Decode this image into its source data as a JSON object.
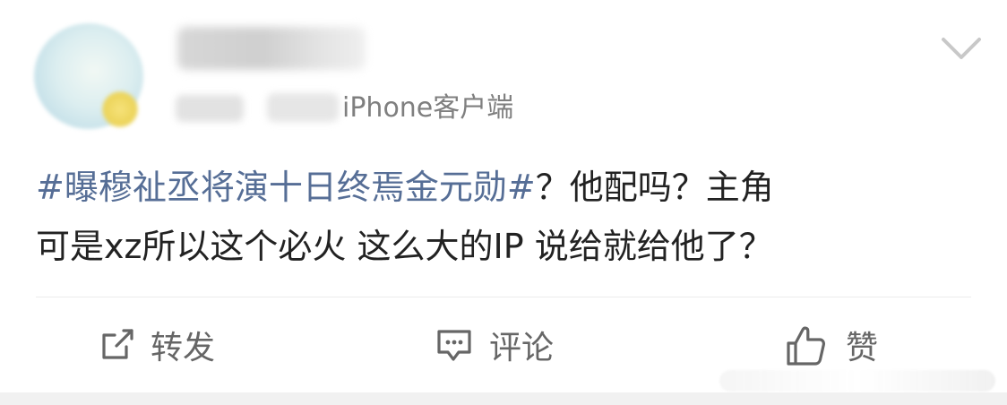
{
  "post": {
    "source": "iPhone客户端",
    "text": {
      "hashtag": "#曝穆祉丞将演十日终焉金元勋#",
      "line1_rest": "？他配吗？主角",
      "line2": "可是xz所以这个必火 这么大的IP 说给就给他了？"
    }
  },
  "actions": {
    "repost": {
      "icon": "repost-icon",
      "label": "转发"
    },
    "comment": {
      "icon": "comment-icon",
      "label": "评论"
    },
    "like": {
      "icon": "thumbs-up-icon",
      "label": "赞"
    }
  },
  "colors": {
    "hashtag": "#566e96",
    "text": "#222222",
    "meta": "#7f7f7f",
    "action": "#666666",
    "divider": "#ececec"
  }
}
